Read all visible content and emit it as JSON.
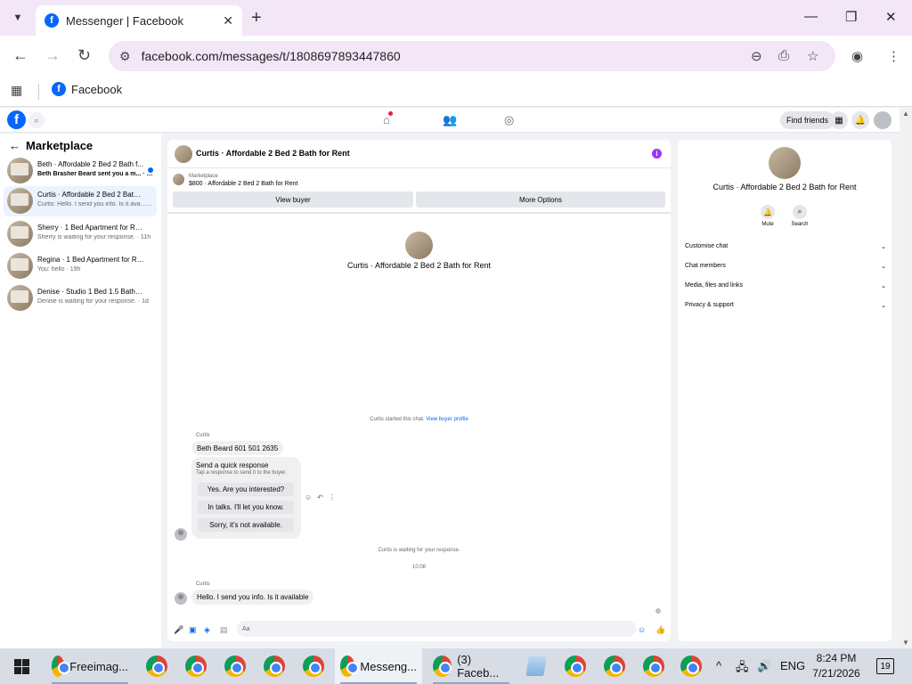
{
  "browser": {
    "tab_title": "Messenger | Facebook",
    "url": "facebook.com/messages/t/1808697893447860",
    "bookmark": "Facebook"
  },
  "fb_header": {
    "find_friends": "Find friends"
  },
  "sidebar": {
    "title": "Marketplace",
    "conversations": [
      {
        "name": "Beth · Affordable 2 Bed 2 Bath f...",
        "preview": "Beth Brasher Beard sent you a m... · 27m",
        "unread": true
      },
      {
        "name": "Curtis · Affordable 2 Bed 2 Bath fo...",
        "preview": "Curtis: Hello. I send you info. Is it ava... · 10h"
      },
      {
        "name": "Sherry · 1 Bed Apartment for Rent",
        "preview": "Sherry is waiting for your response. · 11h"
      },
      {
        "name": "Regina · 1 Bed Apartment for Rent",
        "preview": "You: hello · 19h"
      },
      {
        "name": "Denise · Studio 1 Bed 1.5 Bath for ...",
        "preview": "Denise is waiting for your response. · 1d"
      }
    ]
  },
  "chat": {
    "title": "Curtis · Affordable 2 Bed 2 Bath for Rent",
    "listing_label": "Marketplace",
    "listing_detail": "$800 · Affordable 2 Bed 2 Bath for Rent",
    "view_buyer": "View buyer",
    "more_options": "More Options",
    "profile_name": "Curtis · Affordable 2 Bed 2 Bath for Rent",
    "started_text": "Curtis started this chat.",
    "view_buyer_profile": "View buyer profile",
    "sender": "Curtis",
    "message1": "Beth Beard 601 501 2635",
    "quick_title": "Send a quick response",
    "quick_sub": "Tap a response to send it to the buyer.",
    "quick_options": [
      "Yes. Are you interested?",
      "In talks. I'll let you know.",
      "Sorry, it's not available."
    ],
    "waiting": "Curtis is waiting for your response.",
    "time": "10:08",
    "message2": "Hello. I send you info. Is it available",
    "composer_placeholder": "Aa"
  },
  "right": {
    "name": "Curtis · Affordable 2 Bed 2 Bath for Rent",
    "mute": "Mute",
    "search": "Search",
    "rows": [
      "Customise chat",
      "Chat members",
      "Media, files and links",
      "Privacy & support"
    ]
  },
  "taskbar": {
    "item1": "Freeimag...",
    "item2": "Messeng...",
    "item3": "(3) Faceb...",
    "lang": "ENG",
    "time": "8:24 PM",
    "date": "7/21/2026",
    "notifications": "19"
  }
}
